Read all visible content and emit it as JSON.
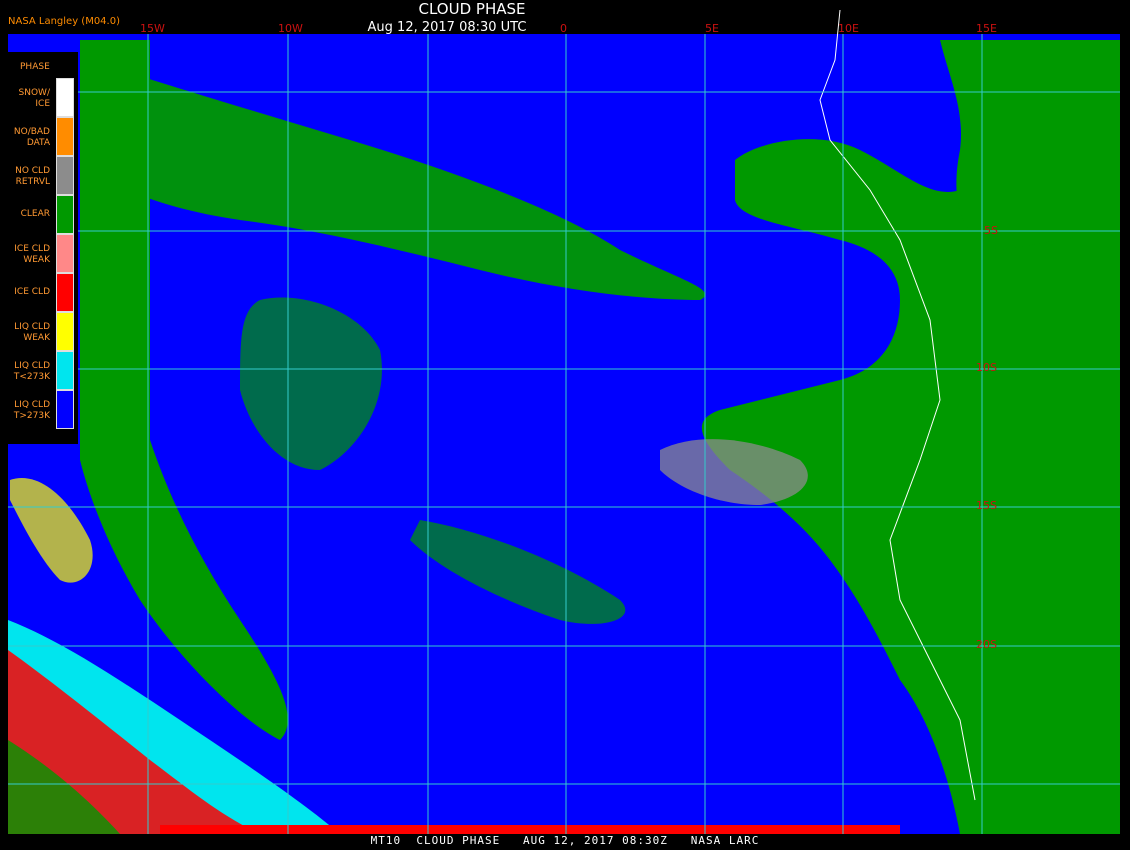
{
  "title": "CLOUD PHASE",
  "datetime": "Aug 12, 2017 08:30 UTC",
  "credit": "NASA Langley (M04.0)",
  "footer": "MT10  CLOUD PHASE   AUG 12, 2017 08:30Z   NASA LARC",
  "legend": {
    "title": "PHASE",
    "items": [
      {
        "line1": "SNOW/",
        "line2": "ICE",
        "color": "#ffffff"
      },
      {
        "line1": "NO/BAD",
        "line2": "DATA",
        "color": "#ff8c00"
      },
      {
        "line1": "NO CLD",
        "line2": "RETRVL",
        "color": "#8c8c8c"
      },
      {
        "line1": "CLEAR",
        "line2": "",
        "color": "#009900"
      },
      {
        "line1": "ICE CLD",
        "line2": "WEAK",
        "color": "#ff8888"
      },
      {
        "line1": "ICE CLD",
        "line2": "",
        "color": "#ff0000"
      },
      {
        "line1": "LIQ CLD",
        "line2": "WEAK",
        "color": "#ffff00"
      },
      {
        "line1": "LIQ CLD",
        "line2": "T<273K",
        "color": "#00e5ee"
      },
      {
        "line1": "LIQ CLD",
        "line2": "T>273K",
        "color": "#0000ff"
      }
    ]
  },
  "graticule": {
    "longitudes": [
      "15W",
      "10W",
      "0",
      "5E",
      "10E",
      "15E"
    ],
    "latitudes": [
      "5S",
      "10S",
      "15S",
      "20S"
    ]
  },
  "colors": {
    "ocean_cloud": "#0000ff",
    "land_clear": "#009900",
    "grid": "#33cccc",
    "coast": "#ffffff"
  }
}
